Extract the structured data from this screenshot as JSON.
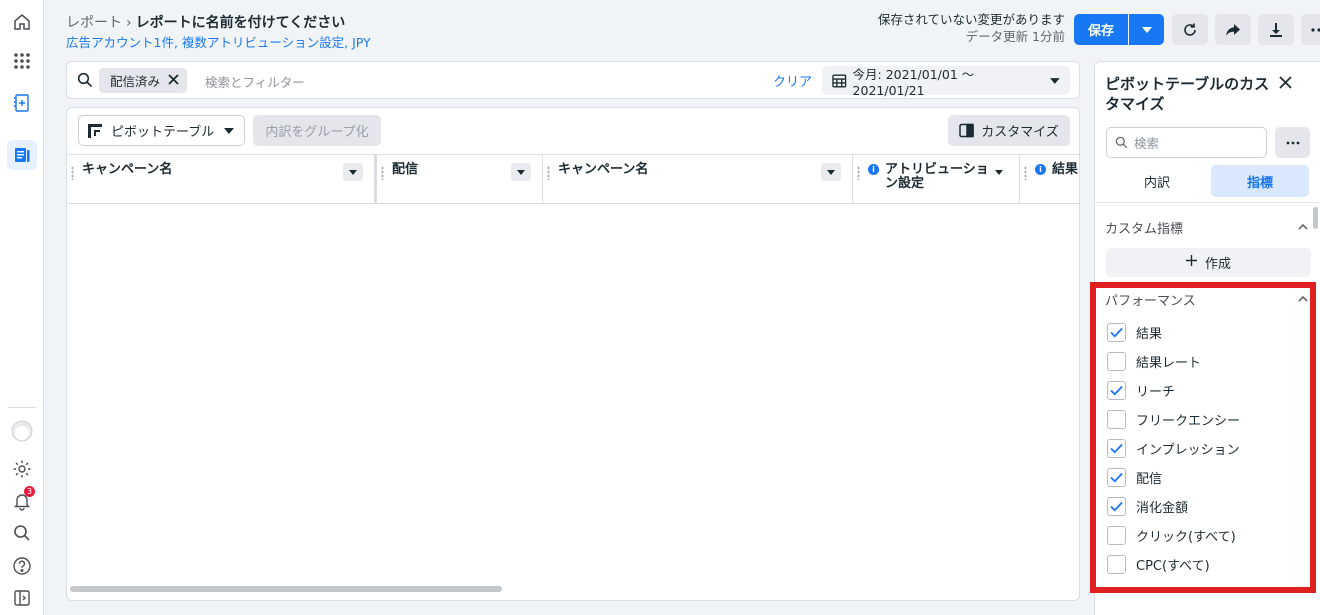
{
  "header": {
    "breadcrumb_parent": "レポート",
    "breadcrumb_current": "レポートに名前を付けてください",
    "sub_info": "広告アカウント1件, 複数アトリビューション設定, JPY",
    "unsaved_text": "保存されていない変更があります",
    "update_text": "データ更新 1分前",
    "save_label": "保存"
  },
  "filter": {
    "chip_label": "配信済み",
    "placeholder": "検索とフィルター",
    "clear_label": "クリア",
    "date_label": "今月: 2021/01/01 ～ 2021/01/21"
  },
  "toolbar": {
    "pivot_label": "ピボットテーブル",
    "group_label": "内訳をグループ化",
    "customize_label": "カスタマイズ"
  },
  "table": {
    "columns": [
      {
        "label": "キャンペーン名"
      },
      {
        "label": "配信"
      },
      {
        "label": "キャンペーン名"
      },
      {
        "label_line1": "アトリビューショ",
        "label_line2": "ン設定"
      },
      {
        "label": "結果"
      }
    ]
  },
  "sidebar": {
    "title": "ピボットテーブルのカスタマイズ",
    "search_placeholder": "検索",
    "tabs": [
      "内訳",
      "指標"
    ],
    "custom_section": "カスタム指標",
    "create_label": "作成",
    "performance_section": "パフォーマンス",
    "metrics": [
      {
        "label": "結果",
        "checked": true
      },
      {
        "label": "結果レート",
        "checked": false
      },
      {
        "label": "リーチ",
        "checked": true
      },
      {
        "label": "フリークエンシー",
        "checked": false
      },
      {
        "label": "インプレッション",
        "checked": true
      },
      {
        "label": "配信",
        "checked": true
      },
      {
        "label": "消化金額",
        "checked": true
      },
      {
        "label": "クリック(すべて)",
        "checked": false
      },
      {
        "label": "CPC(すべて)",
        "checked": false
      }
    ]
  },
  "notifications": {
    "count": "3"
  },
  "colors": {
    "accent": "#1877f2",
    "highlight": "#e02020"
  }
}
